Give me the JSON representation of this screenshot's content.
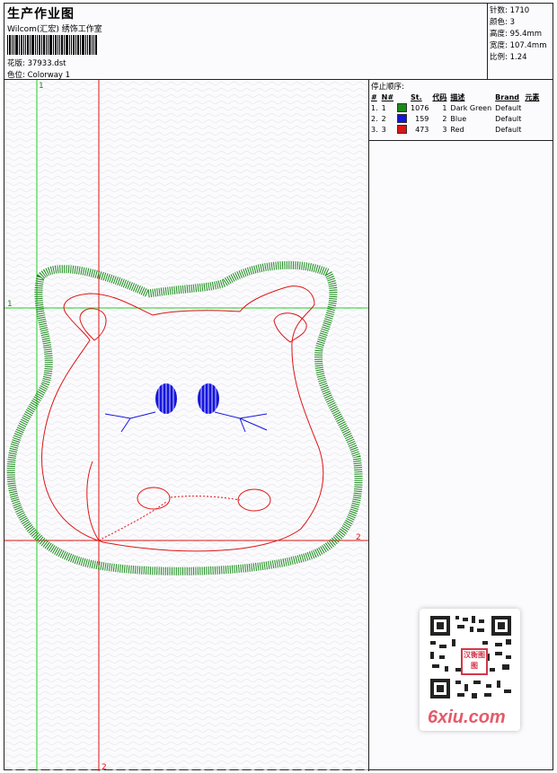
{
  "header": {
    "title": "生产作业图",
    "company": "Wilcom(汇宏) 绣饰工作室",
    "design_label": "花版: 37933.dst",
    "colorway_label": "色位: Colorway 1"
  },
  "stats": [
    {
      "label": "针数:",
      "value": "1710"
    },
    {
      "label": "颜色:",
      "value": "3"
    },
    {
      "label": "高度:",
      "value": "95.4mm"
    },
    {
      "label": "宽度:",
      "value": "107.4mm"
    },
    {
      "label": "比例:",
      "value": "1.24"
    }
  ],
  "stop_sequence": {
    "title": "停止顺序:",
    "columns": [
      "#",
      "N#",
      "St.",
      "代码",
      "描述",
      "Brand",
      "元素"
    ],
    "rows": [
      {
        "idx": "1.",
        "n": "1",
        "color": "#1a8a1a",
        "stitches": "1076",
        "code": "1",
        "desc": "Dark Green",
        "brand": "Default"
      },
      {
        "idx": "2.",
        "n": "2",
        "color": "#1515dd",
        "stitches": "159",
        "code": "2",
        "desc": "Blue",
        "brand": "Default"
      },
      {
        "idx": "3.",
        "n": "3",
        "color": "#dd1515",
        "stitches": "473",
        "code": "3",
        "desc": "Red",
        "brand": "Default"
      }
    ]
  },
  "markers": {
    "v_green": "1",
    "h_green": "1",
    "h_red": "2",
    "v_red": "2"
  },
  "watermark": {
    "brand": "6xiu.com",
    "stamp": "汉衡图图"
  }
}
